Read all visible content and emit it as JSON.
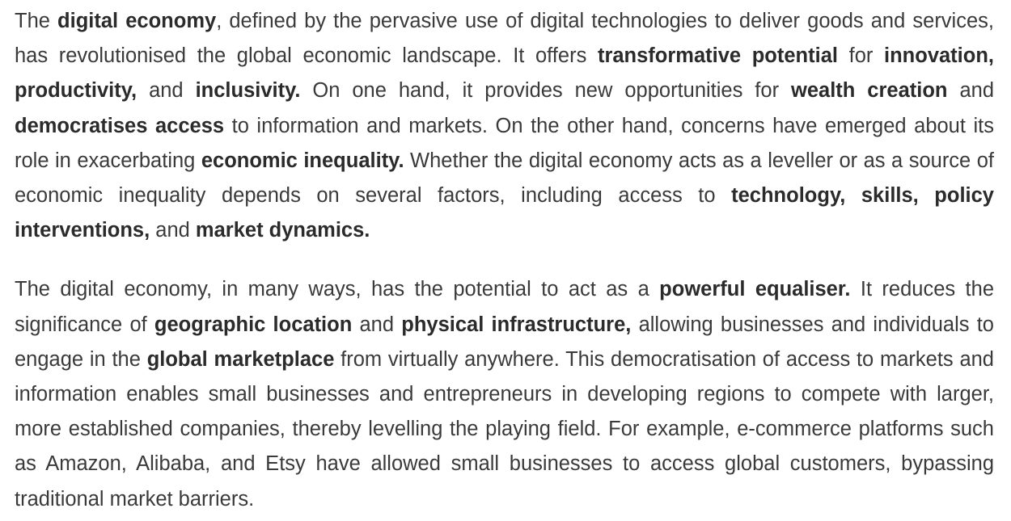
{
  "paragraphs": [
    [
      {
        "text": "The ",
        "bold": false
      },
      {
        "text": "digital economy",
        "bold": true
      },
      {
        "text": ", defined by the pervasive use of digital technologies to deliver goods and services, has revolutionised the global economic landscape. It offers ",
        "bold": false
      },
      {
        "text": "transformative potential",
        "bold": true
      },
      {
        "text": " for ",
        "bold": false
      },
      {
        "text": "innovation, productivity,",
        "bold": true
      },
      {
        "text": " and ",
        "bold": false
      },
      {
        "text": "inclusivity.",
        "bold": true
      },
      {
        "text": " On one hand, it provides new opportunities for ",
        "bold": false
      },
      {
        "text": "wealth creation",
        "bold": true
      },
      {
        "text": " and ",
        "bold": false
      },
      {
        "text": "democratises access",
        "bold": true
      },
      {
        "text": " to information and markets. On the other hand, concerns have emerged about its role in exacerbating ",
        "bold": false
      },
      {
        "text": "economic inequality.",
        "bold": true
      },
      {
        "text": " Whether the digital economy acts as a leveller or as a source of economic inequality depends on several factors, including access to ",
        "bold": false
      },
      {
        "text": "technology, skills, policy interventions,",
        "bold": true
      },
      {
        "text": " and ",
        "bold": false
      },
      {
        "text": "market dynamics.",
        "bold": true
      }
    ],
    [
      {
        "text": "The digital economy, in many ways, has the potential to act as a ",
        "bold": false
      },
      {
        "text": "powerful equaliser.",
        "bold": true
      },
      {
        "text": " It reduces the significance of ",
        "bold": false
      },
      {
        "text": "geographic location",
        "bold": true
      },
      {
        "text": " and ",
        "bold": false
      },
      {
        "text": "physical infrastructure,",
        "bold": true
      },
      {
        "text": " allowing businesses and individuals to engage in the ",
        "bold": false
      },
      {
        "text": "global marketplace",
        "bold": true
      },
      {
        "text": " from virtually anywhere. This democratisation of access to markets and information enables small businesses and entrepreneurs in developing regions to compete with larger, more established companies, thereby levelling the playing field. For example, e-commerce platforms such as Amazon, Alibaba, and Etsy have allowed small businesses to access global customers, bypassing traditional market barriers.",
        "bold": false
      }
    ]
  ]
}
